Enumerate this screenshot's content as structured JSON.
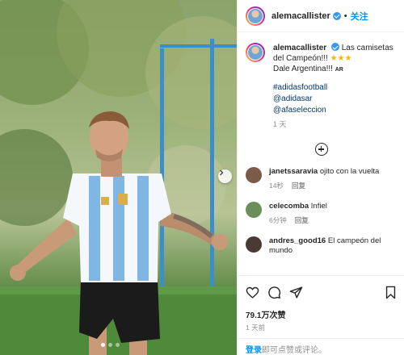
{
  "post": {
    "username": "alemacallister",
    "follow_separator": "•",
    "follow_label": "关注",
    "caption_line1": "Las camisetas del Campeón!!!",
    "caption_stars": "★★★",
    "caption_line2": "Dale Argentina!!!",
    "caption_flag": "AR",
    "hashtag": "#adidasfootball",
    "mention1": "@adidasar",
    "mention2": "@afaseleccion",
    "caption_time": "1 天"
  },
  "comments": [
    {
      "username": "janetssaravia",
      "text": "ojito con la vuelta",
      "time": "14秒",
      "reply": "回复",
      "avatar_color": "#7a5a48"
    },
    {
      "username": "celecomba",
      "text": "Infiel",
      "time": "6分钟",
      "reply": "回复",
      "avatar_color": "#6a8f5a"
    },
    {
      "username": "andres_good16",
      "text": "El campeón del mundo",
      "time": "",
      "reply": "",
      "avatar_color": "#4a3a36"
    }
  ],
  "actions": {
    "likes": "79.1万次赞",
    "date": "1 天前"
  },
  "login_bar": {
    "login_link": "登录",
    "rest": "即可点赞或评论。"
  },
  "icons": [
    "heart-icon",
    "comment-icon",
    "share-icon",
    "bookmark-icon",
    "plus-circle-icon",
    "chevron-right-icon",
    "verified-icon"
  ],
  "colors": {
    "link_blue": "#0095f6",
    "hashtag_blue": "#00376b",
    "verified_blue": "#3897f0",
    "muted": "#8e8e8e"
  }
}
